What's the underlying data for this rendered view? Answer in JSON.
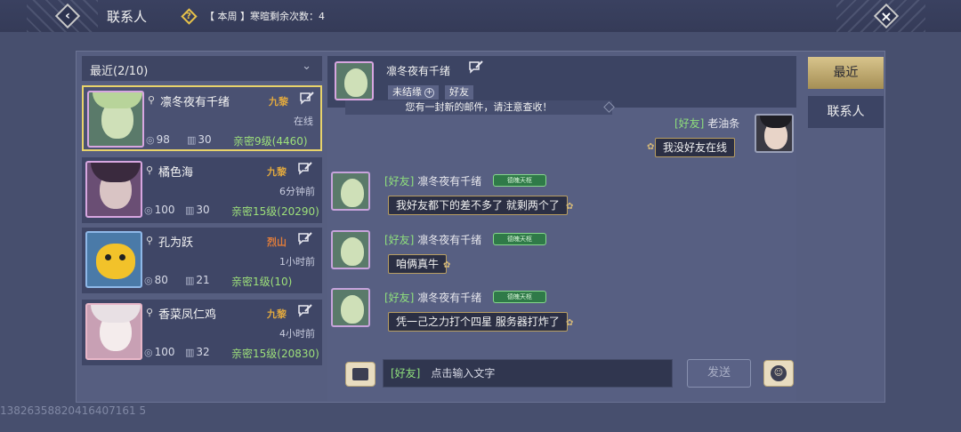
{
  "topbar": {
    "title": "联系人",
    "weekly_text": "【 本周 】寒暄剩余次数：4",
    "help_icon": "help-diamond-icon",
    "back_icon": "back-chevron-icon",
    "close_icon": "close-icon"
  },
  "list": {
    "header_label": "最近(2/10)",
    "contacts": [
      {
        "name": "凛冬夜有千绪",
        "server": "九黎",
        "status": "在线",
        "stat1": "98",
        "stat2": "30",
        "intimacy": "亲密9级(4460)"
      },
      {
        "name": "橘色海",
        "server": "九黎",
        "status": "6分钟前",
        "stat1": "100",
        "stat2": "30",
        "intimacy": "亲密15级(20290)"
      },
      {
        "name": "孔为跃",
        "server": "烈山",
        "status": "1小时前",
        "stat1": "80",
        "stat2": "21",
        "intimacy": "亲密1级(10)"
      },
      {
        "name": "香菜凤仁鸡",
        "server": "九黎",
        "status": "4小时前",
        "stat1": "100",
        "stat2": "32",
        "intimacy": "亲密15级(20830)"
      }
    ]
  },
  "chat": {
    "header_name": "凛冬夜有千绪",
    "tag_unbound": "未结缘",
    "tag_friend": "好友",
    "mail_notice": "您有一封新的邮件，请注意查收！",
    "self_channel": "[好友]",
    "self_name": "老油条",
    "self_message": "我没好友在线",
    "messages": [
      {
        "channel": "[好友]",
        "sender": "凛冬夜有千绪",
        "text": "我好友都下的差不多了 就剩两个了"
      },
      {
        "channel": "[好友]",
        "sender": "凛冬夜有千绪",
        "text": "咱俩真牛"
      },
      {
        "channel": "[好友]",
        "sender": "凛冬夜有千绪",
        "text": "凭一己之力打个四星 服务器打炸了"
      }
    ],
    "badge_text": "德魄天枢",
    "input_channel": "[好友]",
    "input_placeholder": "点击输入文字",
    "send_label": "发送"
  },
  "tabs": {
    "recent": "最近",
    "contacts": "联系人"
  },
  "footer_id": "13826358820416407161 5"
}
